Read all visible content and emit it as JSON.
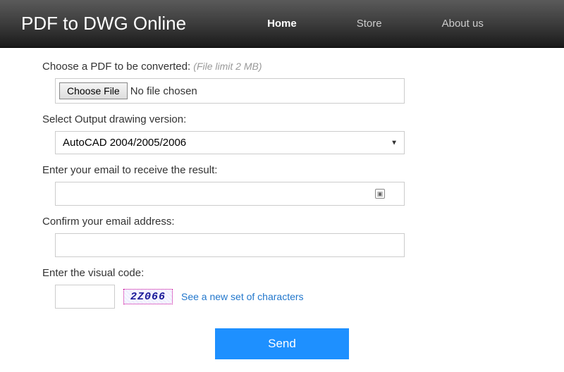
{
  "header": {
    "brand": "PDF to DWG Online",
    "nav": {
      "home": "Home",
      "store": "Store",
      "about": "About us"
    }
  },
  "form": {
    "file": {
      "label": "Choose a PDF to be converted:",
      "hint": "(File limit 2 MB)",
      "button": "Choose File",
      "status": "No file chosen"
    },
    "output": {
      "label": "Select Output drawing version:",
      "selected": "AutoCAD 2004/2005/2006"
    },
    "email": {
      "label": "Enter your email to receive the result:",
      "value": ""
    },
    "confirm": {
      "label": "Confirm your email address:",
      "value": ""
    },
    "captcha": {
      "label": "Enter the visual code:",
      "code": "2Z066",
      "refresh": "See a new set of characters",
      "value": ""
    },
    "submit": "Send"
  }
}
